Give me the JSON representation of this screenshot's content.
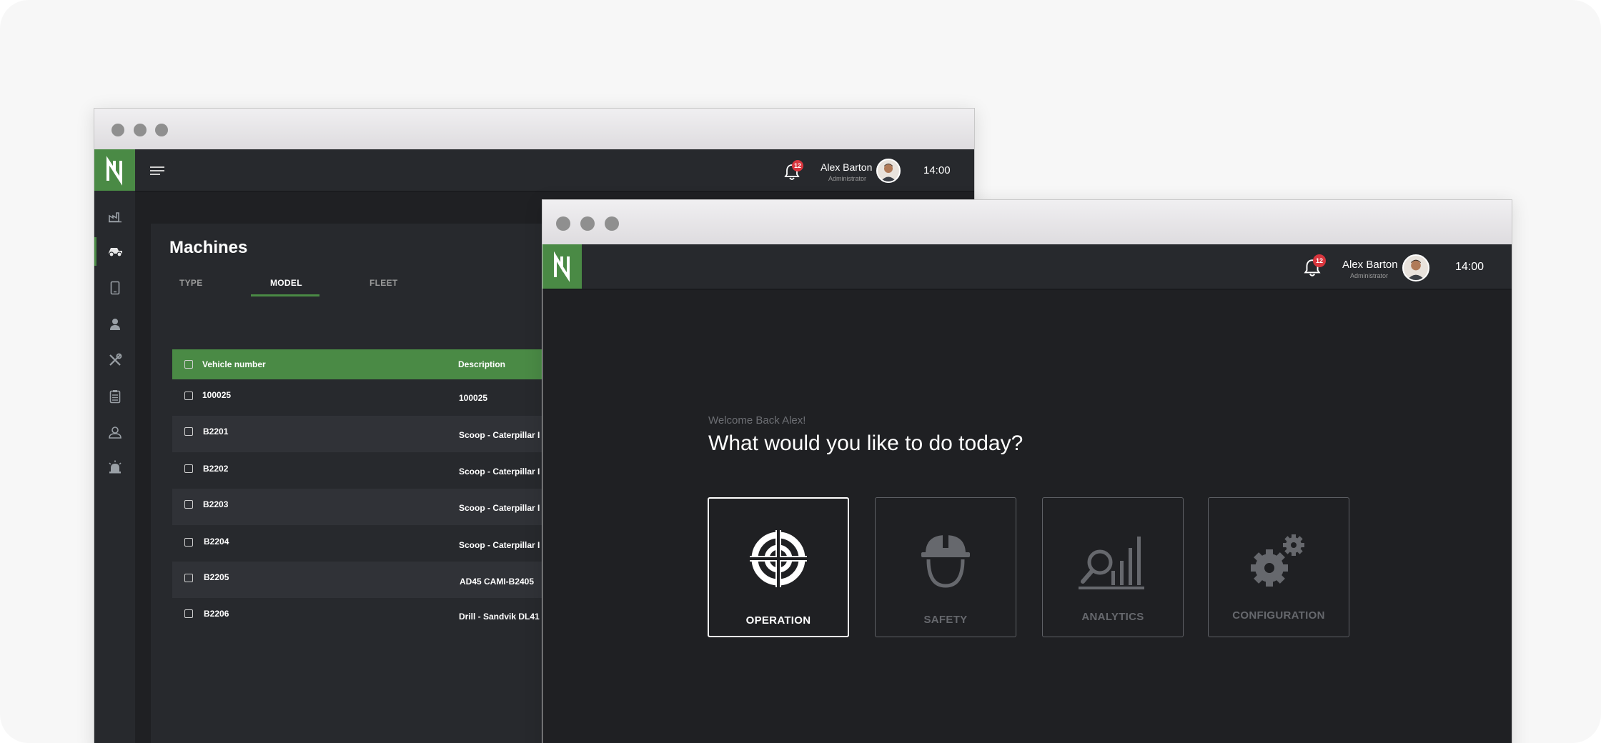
{
  "colors": {
    "accent": "#4a8a45",
    "badge": "#d9363e",
    "background_dark": "#1f2023",
    "panel": "#27292d"
  },
  "back_window": {
    "notifications_count": "12",
    "user": {
      "name": "Alex Barton",
      "role": "Administrator"
    },
    "clock": "14:00",
    "sidebar_icons": [
      "factory-icon",
      "truck-icon",
      "tablet-icon",
      "person-icon",
      "tools-icon",
      "clipboard-icon",
      "worker-icon",
      "alarm-light-icon"
    ],
    "page_title": "Machines",
    "tabs": [
      {
        "label": "TYPE",
        "active": false
      },
      {
        "label": "MODEL",
        "active": true
      },
      {
        "label": "FLEET",
        "active": false
      }
    ],
    "table": {
      "columns": [
        "Vehicle number",
        "Description"
      ],
      "rows": [
        {
          "vehicle": "100025",
          "description": "100025"
        },
        {
          "vehicle": "B2201",
          "description": "Scoop - Caterpillar I"
        },
        {
          "vehicle": "B2202",
          "description": "Scoop - Caterpillar I"
        },
        {
          "vehicle": "B2203",
          "description": "Scoop - Caterpillar I"
        },
        {
          "vehicle": "B2204",
          "description": "Scoop - Caterpillar I"
        },
        {
          "vehicle": "B2205",
          "description": "AD45 CAMI-B2405"
        },
        {
          "vehicle": "B2206",
          "description": "Drill - Sandvik DL41"
        }
      ]
    }
  },
  "front_window": {
    "notifications_count": "12",
    "user": {
      "name": "Alex Barton",
      "role": "Administrator"
    },
    "clock": "14:00",
    "welcome": "Welcome Back Alex!",
    "headline": "What would you like to do today?",
    "tiles": [
      {
        "label": "OPERATION",
        "icon": "target-icon",
        "active": true
      },
      {
        "label": "SAFETY",
        "icon": "hardhat-icon",
        "active": false
      },
      {
        "label": "ANALYTICS",
        "icon": "analytics-icon",
        "active": false
      },
      {
        "label": "CONFIGURATION",
        "icon": "gears-icon",
        "active": false
      }
    ]
  }
}
